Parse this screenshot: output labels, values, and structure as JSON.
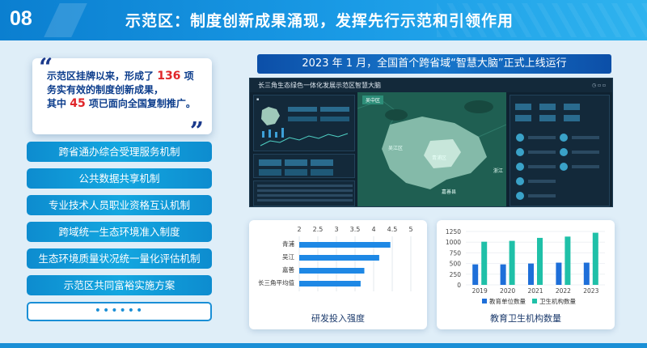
{
  "header": {
    "number": "08",
    "title": "示范区：制度创新成果涌现，发挥先行示范和引领作用"
  },
  "quote": {
    "line1_pre": "示范区挂牌以来，形成了",
    "count_total": "136",
    "line1_post": "项",
    "line2": "务实有效的制度创新成果，",
    "line3_pre": "其中",
    "count_promoted": "45",
    "line3_post": "项已面向全国复制推广。"
  },
  "menu": {
    "items": [
      "跨省通办综合受理服务机制",
      "公共数据共享机制",
      "专业技术人员职业资格互认机制",
      "跨域统一生态环境准入制度",
      "生态环境质量状况统一量化评估机制",
      "示范区共同富裕实施方案"
    ],
    "more": "••••••"
  },
  "banner": "2023 年 1 月，全国首个跨省域“智慧大脑”正式上线运行",
  "dashboard": {
    "title": "长三角生态绿色一体化发展示范区智慧大脑",
    "map_tab": "吴中区",
    "map_labels": [
      "吴江区",
      "嘉善县",
      "青浦区"
    ],
    "map_side_label": "浙江"
  },
  "chart_data": [
    {
      "type": "bar",
      "orientation": "horizontal",
      "title": "研发投入强度",
      "categories": [
        "青浦",
        "吴江",
        "嘉善",
        "长三角平均值"
      ],
      "values": [
        4.45,
        4.15,
        3.75,
        3.65
      ],
      "xlim": [
        2,
        5
      ],
      "xticks": [
        "2",
        "2.5",
        "3",
        "3.5",
        "4",
        "4.5",
        "5"
      ],
      "grid": true,
      "color": "#1e88e5"
    },
    {
      "type": "bar",
      "title": "教育卫生机构数量",
      "categories": [
        "2019",
        "2020",
        "2021",
        "2022",
        "2023"
      ],
      "series": [
        {
          "name": "教育单位数量",
          "values": [
            480,
            480,
            500,
            520,
            520
          ],
          "color": "#1e6fd9"
        },
        {
          "name": "卫生机构数量",
          "values": [
            1010,
            1030,
            1100,
            1130,
            1220
          ],
          "color": "#1fc0a8"
        }
      ],
      "ylim": [
        0,
        1250
      ],
      "yticks": [
        "0",
        "250",
        "500",
        "750",
        "1000",
        "1250"
      ],
      "legend": "bottom"
    }
  ]
}
